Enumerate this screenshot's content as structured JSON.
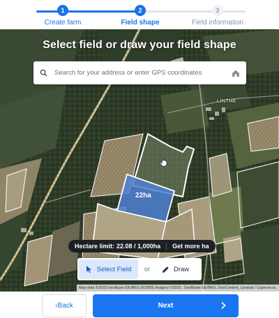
{
  "stepper": {
    "steps": [
      {
        "number": "1",
        "label": "Create farm",
        "state": "done"
      },
      {
        "number": "2",
        "label": "Field shape",
        "state": "active"
      },
      {
        "number": "3",
        "label": "Field information",
        "state": "todo"
      }
    ],
    "accent": "#1a73e8"
  },
  "map": {
    "title": "Select field or draw your field shape",
    "search": {
      "placeholder": "Search for your address or enter GPS coordinates",
      "value": "",
      "left_icon": "search-icon",
      "right_icon": "home-icon"
    },
    "place_label": "LINTHE",
    "selected_area_label": "22ha",
    "hectare_bar": {
      "label": "Hectare limit:",
      "value": "22.08 / 1,000ha",
      "more_link": "Get more ha"
    },
    "tools": {
      "select_label": "Select Field",
      "or_label": "or",
      "draw_label": "Draw",
      "select_icon": "cursor-arrow-icon",
      "draw_icon": "pencil-icon"
    },
    "attribution": "Map data ©2023 GeoBasis-DE/BKG (©2009) Imagery ©2023 , GeoBasis-DE/BKG, GeoContent, Landsat / Copernicus,"
  },
  "footer": {
    "back_label": "‹Back",
    "next_label": "Next",
    "next_color": "#1976f0"
  }
}
